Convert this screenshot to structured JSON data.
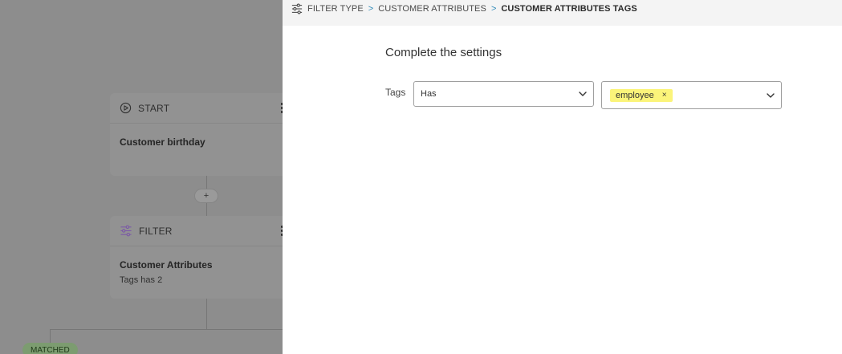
{
  "canvas": {
    "start_node": {
      "type_label": "START",
      "title": "Customer birthday"
    },
    "add_step_label": "+",
    "filter_node": {
      "type_label": "FILTER",
      "title": "Customer Attributes",
      "subtitle": "Tags has 2"
    },
    "matched_label": "MATCHED"
  },
  "panel": {
    "breadcrumb": [
      "FILTER TYPE",
      "CUSTOMER ATTRIBUTES",
      "CUSTOMER ATTRIBUTES TAGS"
    ],
    "heading": "Complete the settings",
    "field_label": "Tags",
    "operator_value": "Has",
    "tags": [
      {
        "label": "employee",
        "remove": "×"
      }
    ]
  },
  "colors": {
    "chip": "#fbf47a",
    "breadcrumb_separator": "#2f8ab8",
    "filter_icon": "#9b6fd0"
  }
}
